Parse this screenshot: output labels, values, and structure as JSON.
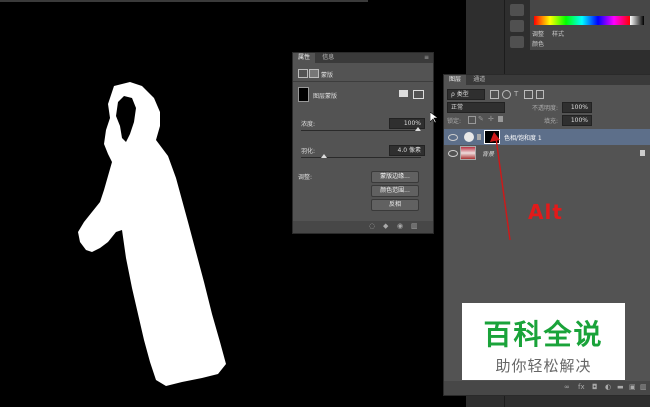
{
  "properties_panel": {
    "tabs": [
      "属性",
      "信息"
    ],
    "mode_label": "蒙版",
    "mask_type_label": "图层蒙版",
    "density_label": "浓度:",
    "density_value": "100%",
    "feather_label": "羽化:",
    "feather_value": "4.0 像素",
    "adjust_label": "调整:",
    "buttons": [
      "蒙版边缘...",
      "颜色范围...",
      "反相"
    ]
  },
  "color_panel": {
    "tabs": [
      "调整",
      "样式"
    ],
    "sub_label": "颜色"
  },
  "layers_panel": {
    "tabs": [
      "图层",
      "通道"
    ],
    "filter_kind": "类型",
    "blend_mode": "正常",
    "opacity_label": "不透明度:",
    "opacity_value": "100%",
    "lock_label": "锁定:",
    "fill_label": "填充:",
    "fill_value": "100%",
    "layers": [
      {
        "name": "色相/饱和度 1",
        "selected": true,
        "type": "adjustment"
      },
      {
        "name": "背景",
        "selected": false,
        "type": "background",
        "locked": true
      }
    ]
  },
  "annotation": {
    "text": "Alt",
    "color": "#e21a1a"
  },
  "watermark": {
    "title": "百科全说",
    "subtitle": "助你轻松解决",
    "title_color": "#1aa33a"
  }
}
